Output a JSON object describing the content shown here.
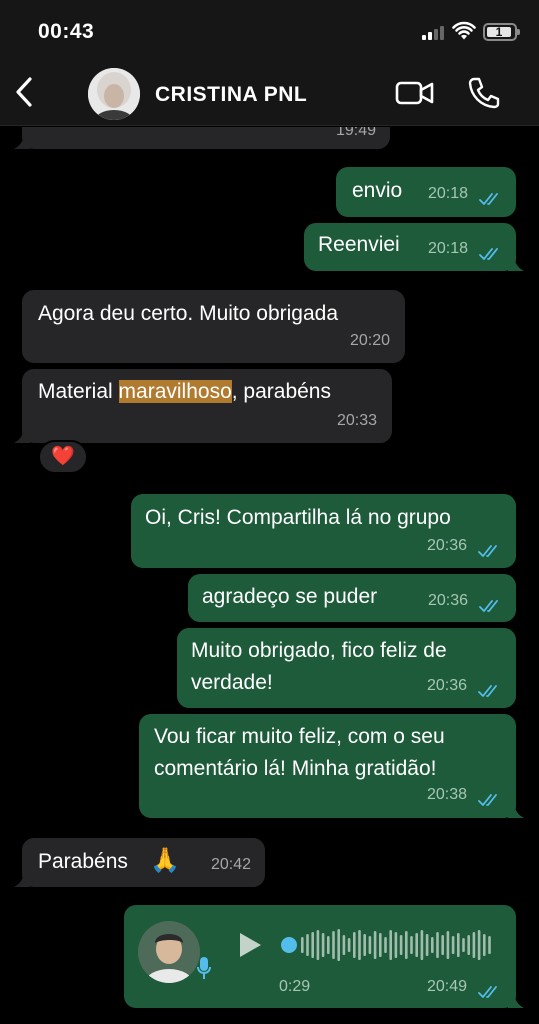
{
  "status": {
    "time": "00:43",
    "battery": "1"
  },
  "header": {
    "contact_name": "CRISTINA PNL"
  },
  "messages": [
    {
      "text": "",
      "time": "19:49"
    },
    {
      "text": "envio",
      "time": "20:18"
    },
    {
      "text": "Reenviei",
      "time": "20:18"
    },
    {
      "text": "Agora deu certo. Muito obrigada",
      "time": "20:20"
    },
    {
      "text_before": "Material ",
      "text_highlight": "maravilhoso",
      "text_after": ", parabéns",
      "time": "20:33",
      "reaction": "❤️"
    },
    {
      "text": "Oi, Cris! Compartilha lá no grupo",
      "time": "20:36"
    },
    {
      "text": "agradeço se puder",
      "time": "20:36"
    },
    {
      "line1": "Muito obrigado, fico feliz de",
      "line2": "verdade!",
      "time": "20:36"
    },
    {
      "line1": "Vou ficar muito feliz, com o seu",
      "line2": "comentário lá! Minha gratidão!",
      "time": "20:38"
    },
    {
      "text": "Parabéns",
      "emoji": "🙏",
      "time": "20:42"
    },
    {
      "duration": "0:29",
      "time": "20:49"
    }
  ],
  "colors": {
    "incoming": "#262628",
    "outgoing": "#1e5b3b",
    "tick": "#53bdeb",
    "highlight": "#b07a2f"
  },
  "icons": {
    "back": "chevron-left-icon",
    "video": "video-camera-icon",
    "call": "phone-icon",
    "play": "play-icon",
    "mic": "microphone-icon",
    "ticks": "double-check-icon"
  }
}
